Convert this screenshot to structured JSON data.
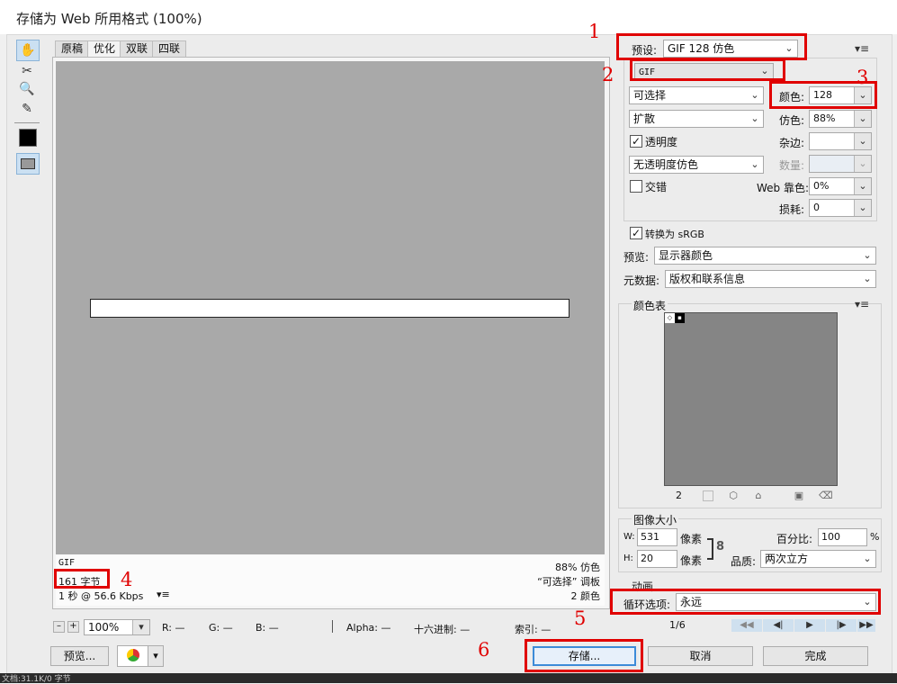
{
  "window": {
    "title": "存储为 Web 所用格式 (100%)"
  },
  "tools": {
    "hand": "✋",
    "slice_select": "✂",
    "zoom": "🔍",
    "eyedropper": "✎"
  },
  "tabs": [
    "原稿",
    "优化",
    "双联",
    "四联"
  ],
  "info": {
    "format": "GIF",
    "size": "161 字节",
    "time": "1 秒 @ 56.6 Kbps",
    "menu": "▾≡",
    "dither": "88% 仿色",
    "palette": "“可选择” 调板",
    "colors": "2 颜色"
  },
  "bottom_bar": {
    "zoom_minus": "–",
    "zoom_plus": "+",
    "zoom": "100%",
    "r": "R: —",
    "g": "G: —",
    "b": "B: —",
    "alpha": "Alpha: —",
    "hex": "十六进制: —",
    "index": "索引: —"
  },
  "buttons": {
    "preview": "预览...",
    "save": "存储...",
    "cancel": "取消",
    "done": "完成"
  },
  "settings": {
    "preset_label": "预设:",
    "preset_value": "GIF 128 仿色",
    "format_value": "GIF",
    "reduction_value": "可选择",
    "dither_algo": "扩散",
    "transparency_label": "透明度",
    "transparency_checked": "✓",
    "trans_dither": "无透明度仿色",
    "interlace_label": "交错",
    "colors_label": "颜色:",
    "colors_value": "128",
    "dither_label": "仿色:",
    "dither_value": "88%",
    "matte_label": "杂边:",
    "amount_label": "数量:",
    "websnap_label": "Web 靠色:",
    "websnap_value": "0%",
    "lossy_label": "损耗:",
    "lossy_value": "0",
    "convert_srgb_label": "转换为 sRGB",
    "convert_srgb_checked": "✓",
    "preview_label": "预览:",
    "preview_value": "显示器颜色",
    "metadata_label": "元数据:",
    "metadata_value": "版权和联系信息",
    "panel_menu": "▾≡"
  },
  "color_table": {
    "title": "颜色表",
    "count": "2",
    "menu": "▾≡",
    "swatch_white_mark": "◇",
    "swatch_black_mark": "▪"
  },
  "image_size": {
    "title": "图像大小",
    "w_label": "W:",
    "w_value": "531",
    "h_label": "H:",
    "h_value": "20",
    "px_label_w": "像素",
    "px_label_h": "像素",
    "percent_label": "百分比:",
    "percent_value": "100",
    "percent_unit": "%",
    "quality_label": "品质:",
    "quality_value": "两次立方",
    "link_icon": "8"
  },
  "animation": {
    "title": "动画",
    "loop_label": "循环选项:",
    "loop_value": "永远",
    "frame": "1/6",
    "first": "◀◀",
    "prev": "◀|",
    "play": "▶",
    "next": "|▶",
    "last": "▶▶"
  },
  "annotations": [
    "1",
    "2",
    "3",
    "4",
    "5",
    "6"
  ],
  "status": "文档:31.1K/0 字节",
  "colors": {
    "annotation_red": "#e00000",
    "canvas_gray": "#a9a9a9",
    "table_gray": "#858585"
  }
}
